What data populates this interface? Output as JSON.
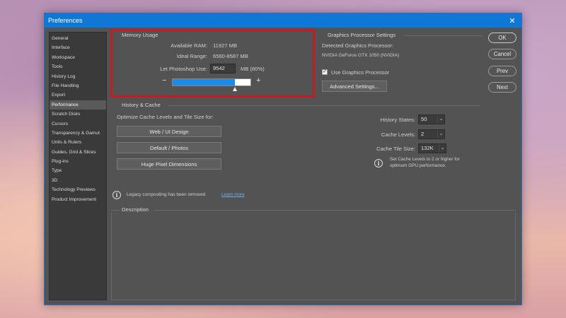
{
  "window": {
    "title": "Preferences"
  },
  "sidebar": {
    "items": [
      {
        "label": "General"
      },
      {
        "label": "Interface"
      },
      {
        "label": "Workspace"
      },
      {
        "label": "Tools"
      },
      {
        "label": "History Log"
      },
      {
        "label": "File Handling"
      },
      {
        "label": "Export"
      },
      {
        "label": "Performance",
        "active": true
      },
      {
        "label": "Scratch Disks"
      },
      {
        "label": "Cursors"
      },
      {
        "label": "Transparency & Gamut"
      },
      {
        "label": "Units & Rulers"
      },
      {
        "label": "Guides, Grid & Slices"
      },
      {
        "label": "Plug-ins"
      },
      {
        "label": "Type"
      },
      {
        "label": "3D"
      },
      {
        "label": "Technology Previews"
      },
      {
        "label": "Product Improvement"
      }
    ]
  },
  "memory": {
    "title": "Memory Usage",
    "available_label": "Available RAM:",
    "available_value": "11927 MB",
    "ideal_label": "Ideal Range:",
    "ideal_value": "6560-8587 MB",
    "let_label": "Let Photoshop Use:",
    "let_value": "9542",
    "let_unit": "MB (80%)",
    "slider_fraction": 0.8,
    "minus": "−",
    "plus": "+"
  },
  "gpu": {
    "title": "Graphics Processor Settings",
    "detected_label": "Detected Graphics Processor:",
    "detected_value": "NVIDIA GeForce GTX 1050 (NVIDIA)",
    "use_label": "Use Graphics Processor",
    "use_checked": true,
    "advanced_button": "Advanced Settings..."
  },
  "history_cache": {
    "title": "History & Cache",
    "optimize_label": "Optimize Cache Levels and Tile Size for:",
    "buttons": [
      "Web / UI Design",
      "Default / Photos",
      "Huge Pixel Dimensions"
    ],
    "history_states_label": "History States:",
    "history_states_value": "50",
    "cache_levels_label": "Cache Levels:",
    "cache_levels_value": "2",
    "tile_size_label": "Cache Tile Size:",
    "tile_size_value": "132K",
    "info_text": "Set Cache Levels to 2 or higher for optimum GPU performance."
  },
  "legacy": {
    "text": "Legacy compositing has been removed",
    "link": "Learn more"
  },
  "description": {
    "title": "Description"
  },
  "actions": {
    "ok": "OK",
    "cancel": "Cancel",
    "prev": "Prev",
    "next": "Next"
  },
  "colors": {
    "titlebar": "#0f78d7",
    "highlight": "#c41e24",
    "slider_fill": "#1e8ae6",
    "dialog_bg": "#535353"
  }
}
